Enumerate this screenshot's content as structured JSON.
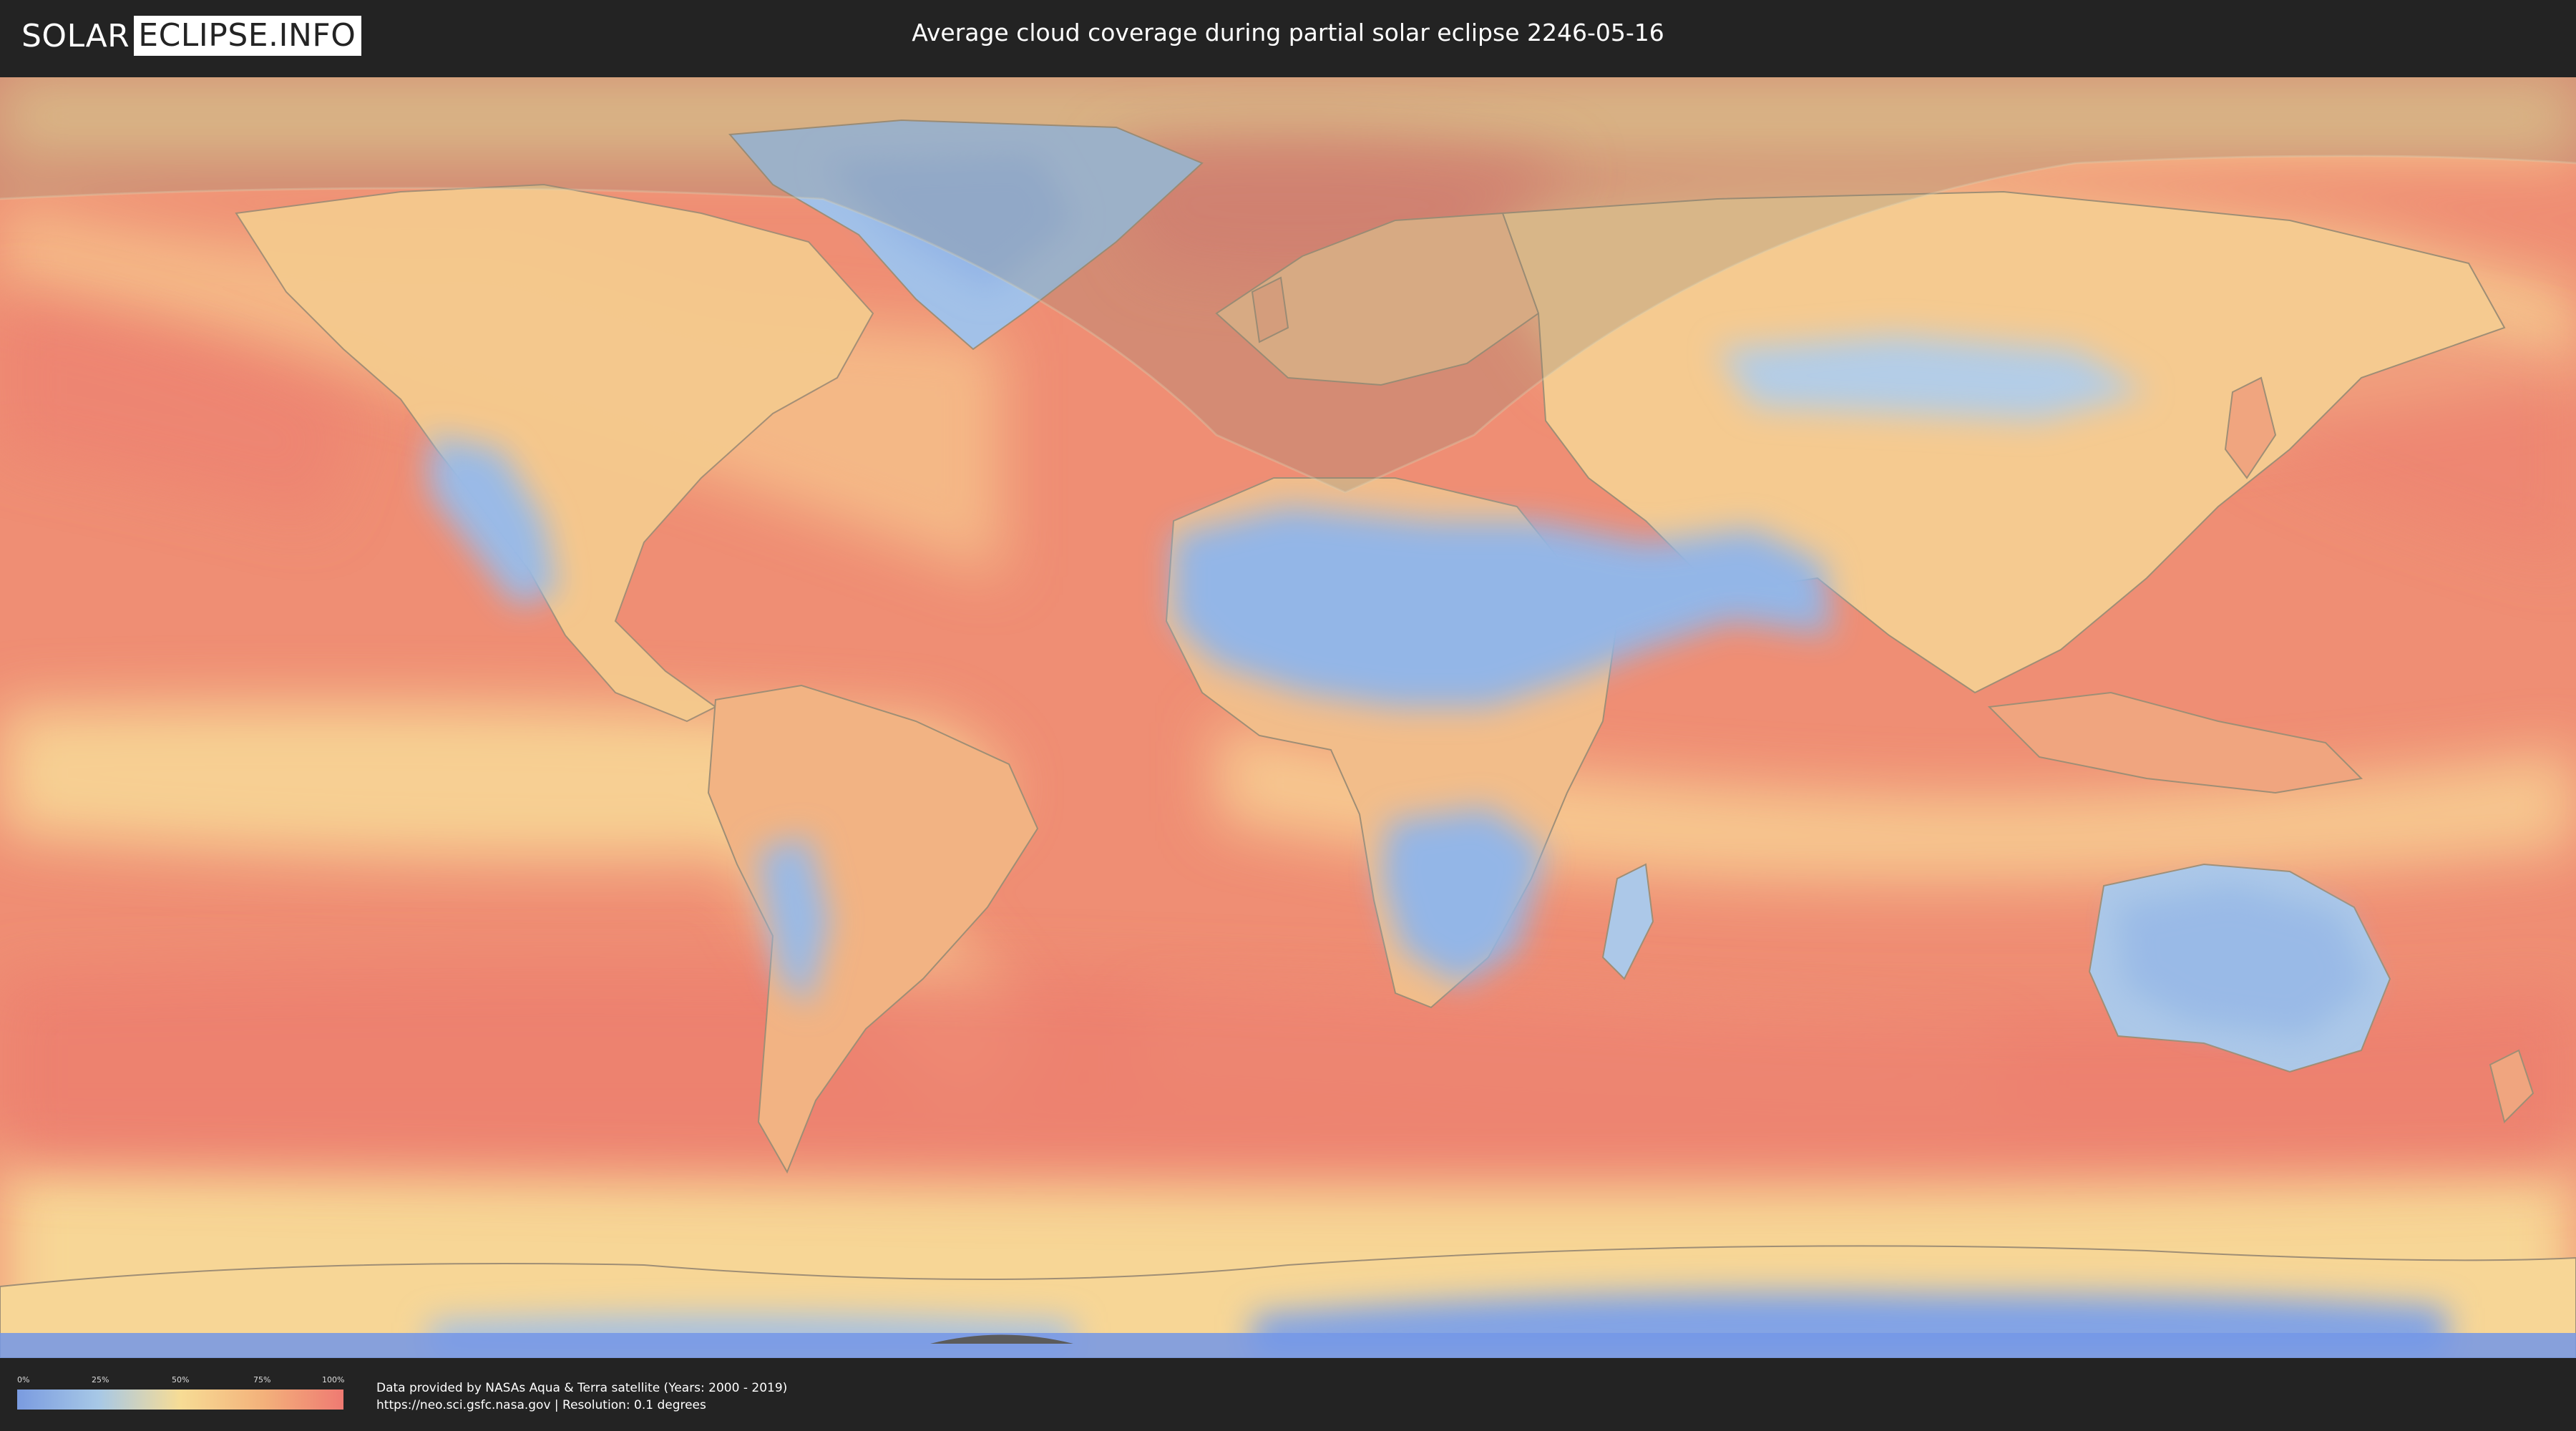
{
  "header": {
    "logo_left": "SOLAR",
    "logo_right": "ECLIPSE.INFO",
    "title": "Average cloud coverage during partial solar eclipse 2246-05-16"
  },
  "map": {
    "colors": {
      "ocean_cloudy": "#ef8a6f",
      "mid_cloud": "#f7d592",
      "low_cloud": "#8fb3e6",
      "very_low_cloud": "#6f93e6",
      "eclipse_shade": "#8a8070"
    }
  },
  "legend": {
    "ticks": [
      "0%",
      "25%",
      "50%",
      "75%",
      "100%"
    ],
    "gradient": [
      "#7a9be0",
      "#a7c8e6",
      "#f7dc95",
      "#f3b27b",
      "#ef7a72"
    ]
  },
  "footer": {
    "credit_line1": "Data provided by NASAs Aqua & Terra satellite (Years: 2000 - 2019)",
    "credit_line2": "https://neo.sci.gsfc.nasa.gov | Resolution: 0.1 degrees"
  }
}
